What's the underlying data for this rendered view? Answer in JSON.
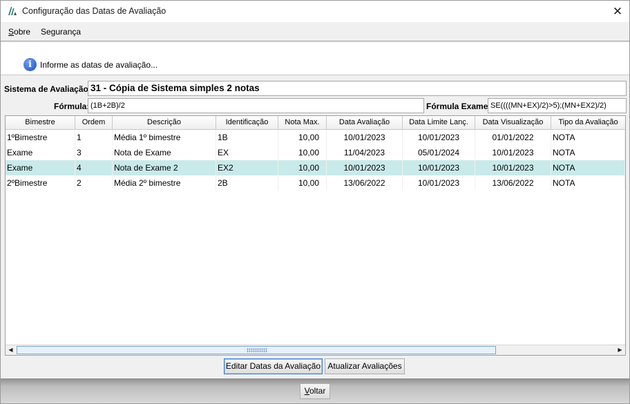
{
  "window": {
    "title": "Configuração das Datas de Avaliação"
  },
  "menu": {
    "items": [
      {
        "prefix": "S",
        "rest": "obre"
      },
      {
        "prefix": "",
        "rest": "Segurança"
      }
    ]
  },
  "info": {
    "text": "Informe as datas de avaliação..."
  },
  "form": {
    "sistema_label": "Sistema de Avaliação:",
    "sistema_value": "31 - Cópia de Sistema simples 2 notas",
    "formula_label": "Fórmula:",
    "formula_value": "(1B+2B)/2",
    "formula_exame_label": "Fórmula Exame:",
    "formula_exame_value": "SE((((MN+EX)/2)>5);(MN+EX2)/2)"
  },
  "grid": {
    "columns": [
      "Bimestre",
      "Ordem",
      "Descrição",
      "Identificação",
      "Nota Max.",
      "Data Avaliação",
      "Data Limite Lanç.",
      "Data Visualização",
      "Tipo da Avaliação"
    ],
    "rows": [
      [
        "1ºBimestre",
        "1",
        "Média 1º bimestre",
        "1B",
        "10,00",
        "10/01/2023",
        "10/01/2023",
        "01/01/2022",
        "NOTA"
      ],
      [
        "Exame",
        "3",
        "Nota de Exame",
        "EX",
        "10,00",
        "11/04/2023",
        "05/01/2024",
        "10/01/2023",
        "NOTA"
      ],
      [
        "Exame",
        "4",
        "Nota de Exame 2",
        "EX2",
        "10,00",
        "10/01/2023",
        "10/01/2023",
        "10/01/2023",
        "NOTA"
      ],
      [
        "2ºBimestre",
        "2",
        "Média 2º bimestre",
        "2B",
        "10,00",
        "13/06/2022",
        "10/01/2023",
        "13/06/2022",
        "NOTA"
      ]
    ],
    "selected_row": 2
  },
  "buttons": {
    "editar_label": "Editar Datas da Avaliação",
    "atualizar_label": "Atualizar Avaliações",
    "voltar_prefix": "V",
    "voltar_rest": "oltar"
  },
  "colors": {
    "selected_row": "#c9eaea",
    "accent": "#3a7bd5"
  },
  "icons": {
    "app": "app-logo-icon",
    "info": "info-icon",
    "close": "close-icon"
  }
}
